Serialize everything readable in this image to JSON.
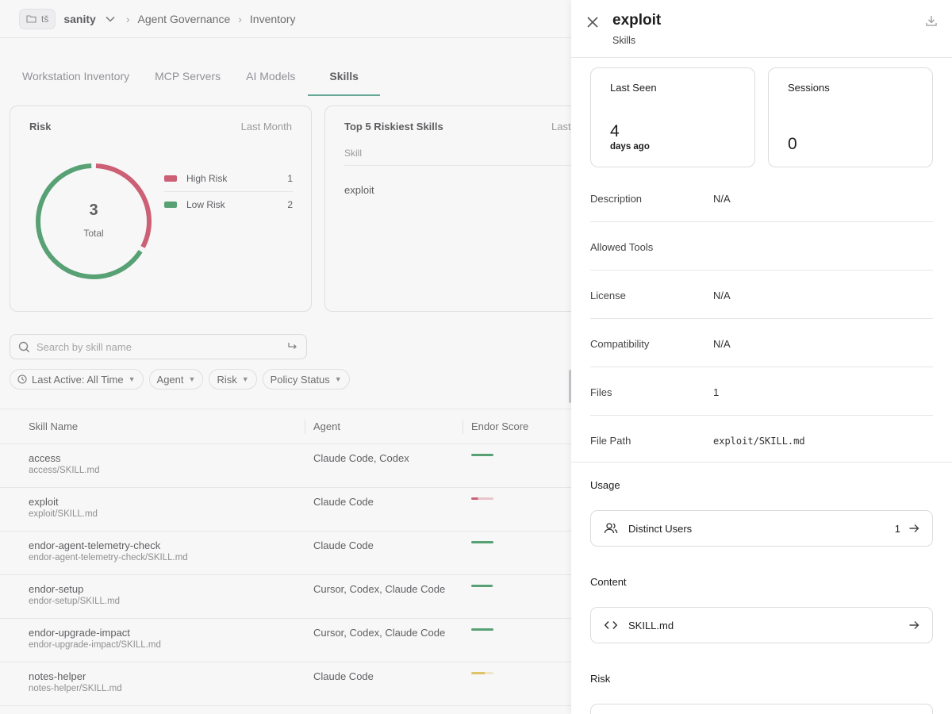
{
  "topbar": {
    "workspace_badge": "tš",
    "workspace_name": "sanity",
    "breadcrumb": [
      "Agent Governance",
      "Inventory"
    ]
  },
  "tabs": [
    "Workstation Inventory",
    "MCP Servers",
    "AI Models",
    "Skills"
  ],
  "active_tab": "Skills",
  "risk_card": {
    "title": "Risk",
    "range": "Last Month",
    "total": "3",
    "total_label": "Total",
    "legend": [
      {
        "label": "High Risk",
        "value": "1",
        "color": "#c0213f"
      },
      {
        "label": "Low Risk",
        "value": "2",
        "color": "#15803d"
      }
    ]
  },
  "top5_card": {
    "title": "Top 5 Riskiest Skills",
    "range": "Last",
    "column": "Skill",
    "rows": [
      "exploit"
    ]
  },
  "search": {
    "placeholder": "Search by skill name"
  },
  "filters": [
    "Last Active: All Time",
    "Agent",
    "Risk",
    "Policy Status"
  ],
  "table": {
    "columns": [
      "Skill Name",
      "Agent",
      "Endor Score"
    ],
    "rows": [
      {
        "name": "access",
        "path": "access/SKILL.md",
        "agent": "Claude Code, Codex",
        "score_color": "#15803d",
        "score_fill": 1.0
      },
      {
        "name": "exploit",
        "path": "exploit/SKILL.md",
        "agent": "Claude Code",
        "score_color": "#c0213f",
        "score_fill": 0.3
      },
      {
        "name": "endor-agent-telemetry-check",
        "path": "endor-agent-telemetry-check/SKILL.md",
        "agent": "Claude Code",
        "score_color": "#15803d",
        "score_fill": 1.0
      },
      {
        "name": "endor-setup",
        "path": "endor-setup/SKILL.md",
        "agent": "Cursor, Codex, Claude Code",
        "score_color": "#15803d",
        "score_fill": 0.95
      },
      {
        "name": "endor-upgrade-impact",
        "path": "endor-upgrade-impact/SKILL.md",
        "agent": "Cursor, Codex, Claude Code",
        "score_color": "#15803d",
        "score_fill": 1.0
      },
      {
        "name": "notes-helper",
        "path": "notes-helper/SKILL.md",
        "agent": "Claude Code",
        "score_color": "#d9b42a",
        "score_fill": 0.6
      }
    ]
  },
  "panel": {
    "title": "exploit",
    "subtitle": "Skills",
    "last_seen": {
      "label": "Last Seen",
      "value": "4",
      "unit": "days ago"
    },
    "sessions": {
      "label": "Sessions",
      "value": "0"
    },
    "properties": [
      {
        "key": "Description",
        "value": "N/A"
      },
      {
        "key": "Allowed Tools",
        "value": ""
      },
      {
        "key": "License",
        "value": "N/A"
      },
      {
        "key": "Compatibility",
        "value": "N/A"
      },
      {
        "key": "Files",
        "value": "1"
      },
      {
        "key": "File Path",
        "value": "exploit/SKILL.md"
      }
    ],
    "usage": {
      "title": "Usage",
      "item_label": "Distinct Users",
      "item_count": "1"
    },
    "content": {
      "title": "Content",
      "item_label": "SKILL.md"
    },
    "risk": {
      "title": "Risk"
    }
  }
}
